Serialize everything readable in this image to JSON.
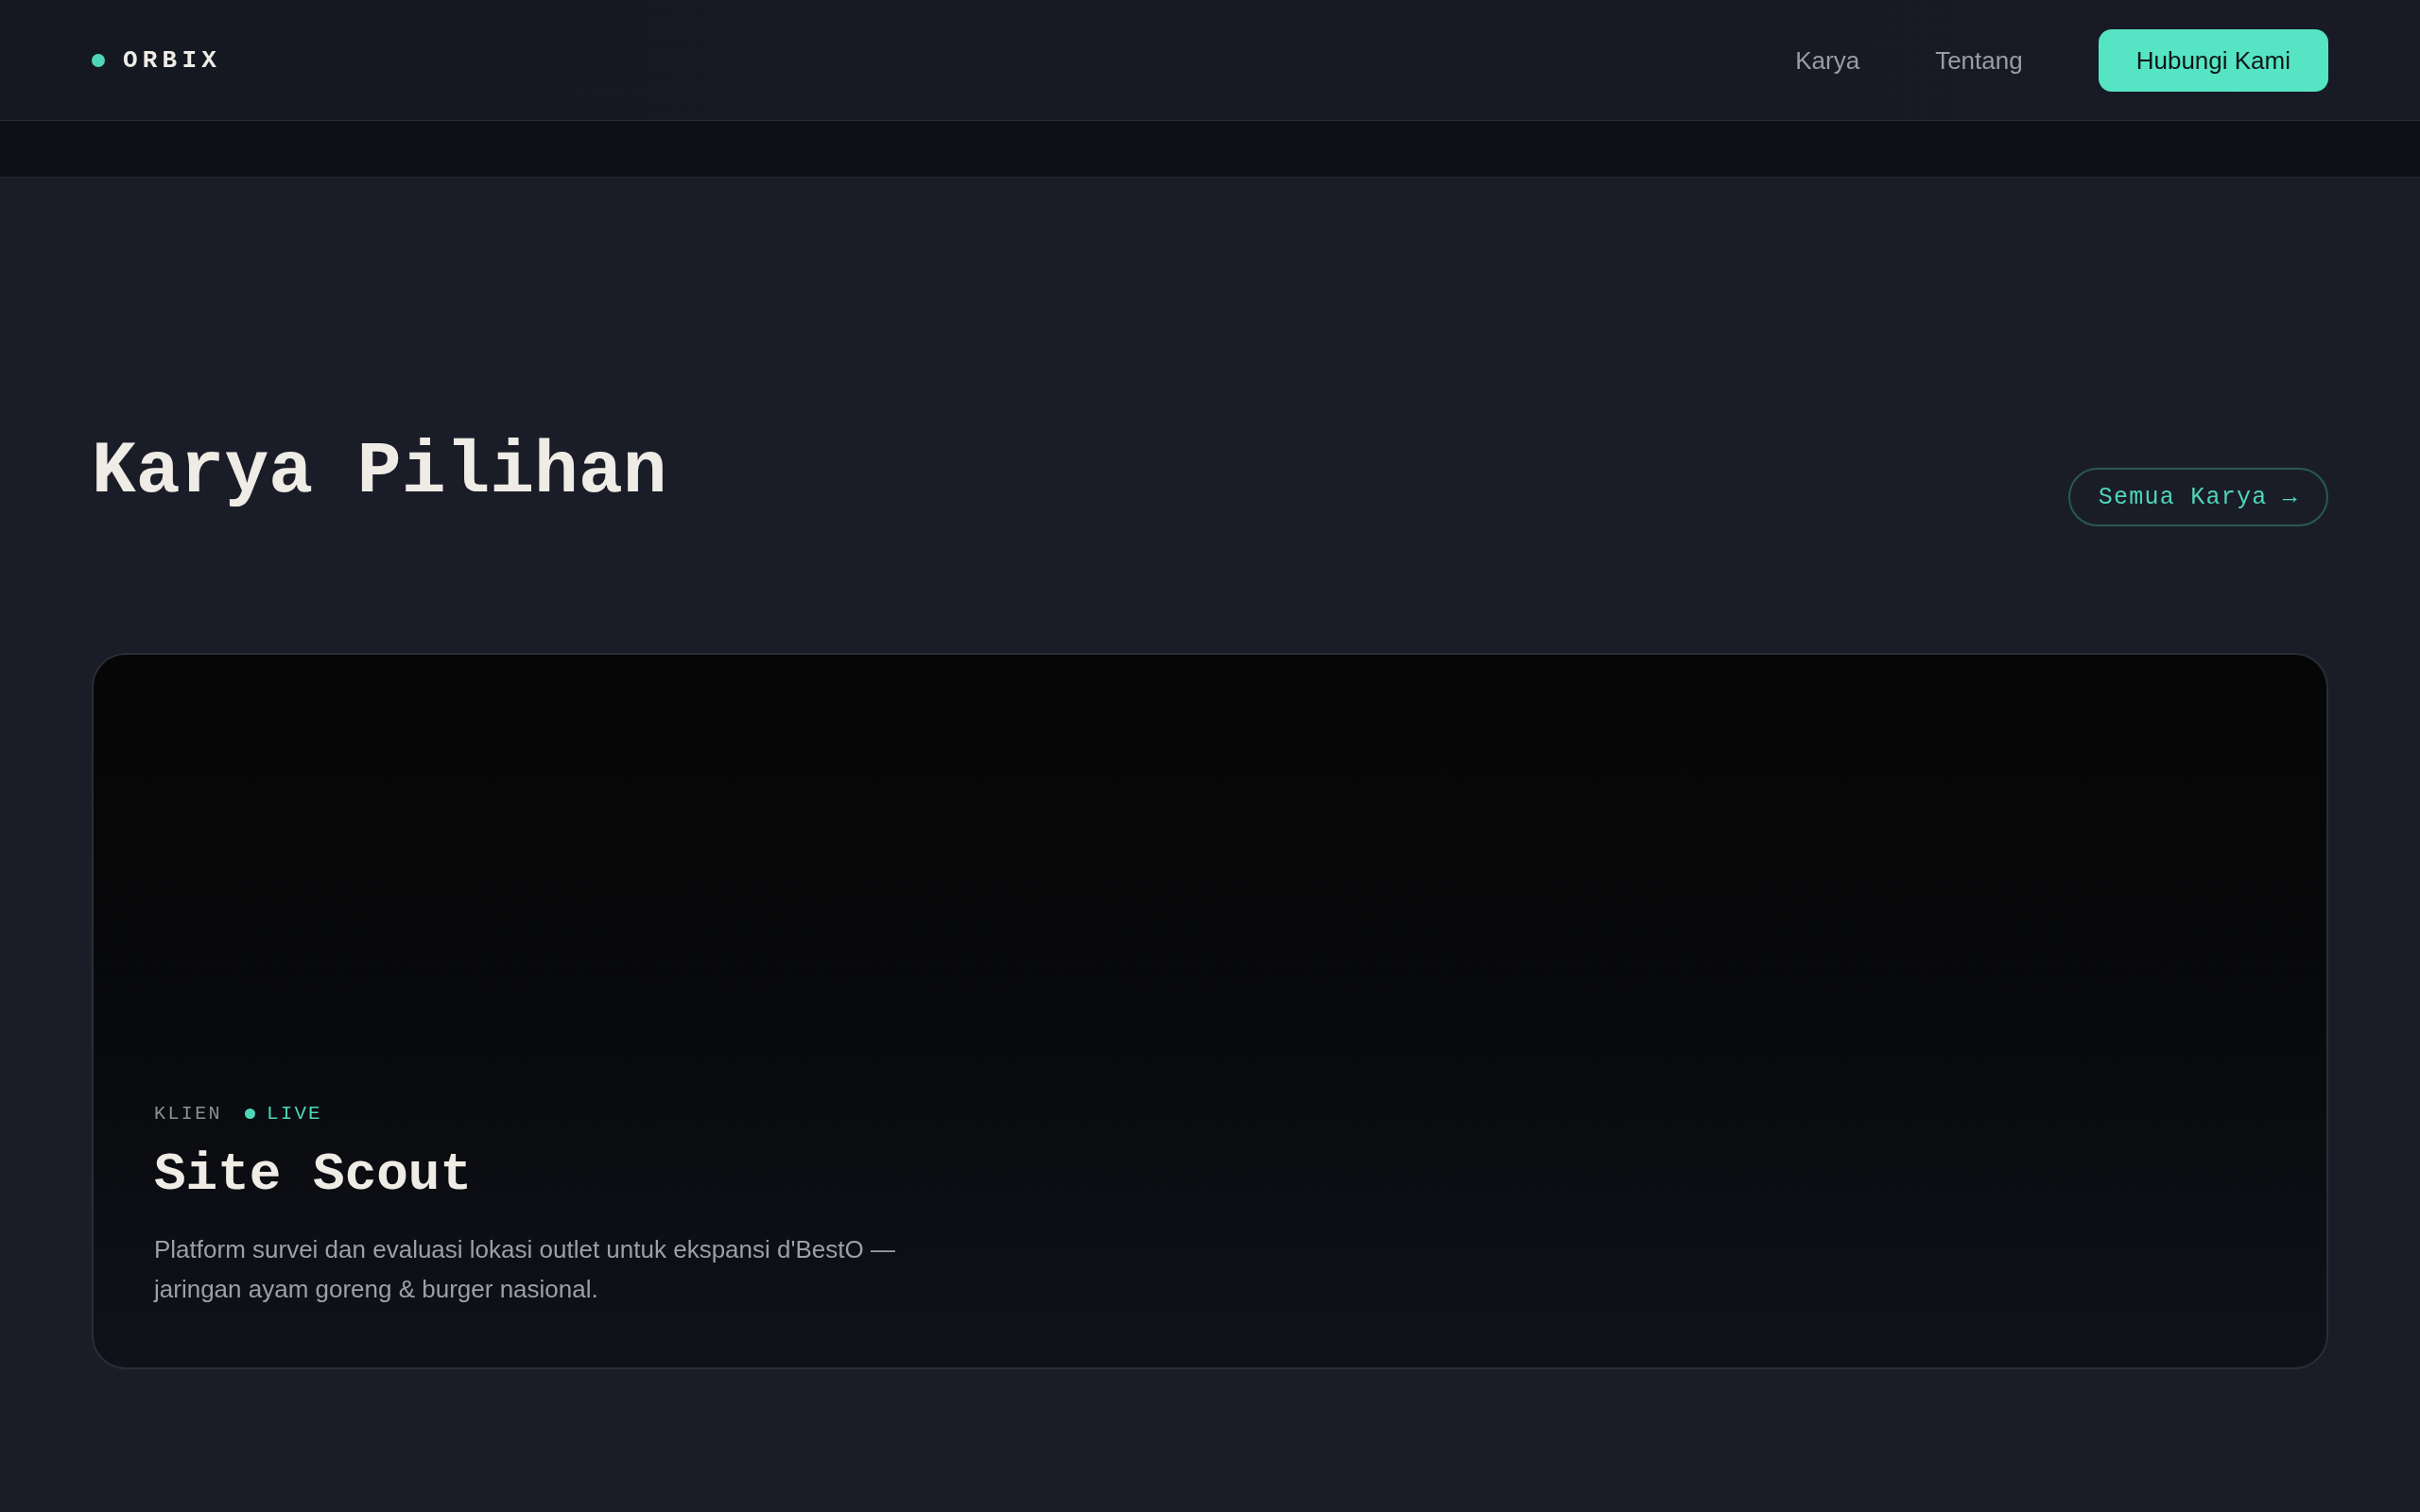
{
  "header": {
    "logo": "ORBIX",
    "nav": [
      {
        "label": "Karya"
      },
      {
        "label": "Tentang"
      }
    ],
    "cta": "Hubungi Kami"
  },
  "section": {
    "title": "Karya Pilihan",
    "link": "Semua Karya →"
  },
  "projects": [
    {
      "tag": "KLIEN",
      "status": "LIVE",
      "live": true,
      "title": "Site Scout",
      "description": "Platform survei dan evaluasi lokasi outlet untuk ekspansi d'BestO — jaringan ayam goreng & burger nasional."
    }
  ]
}
